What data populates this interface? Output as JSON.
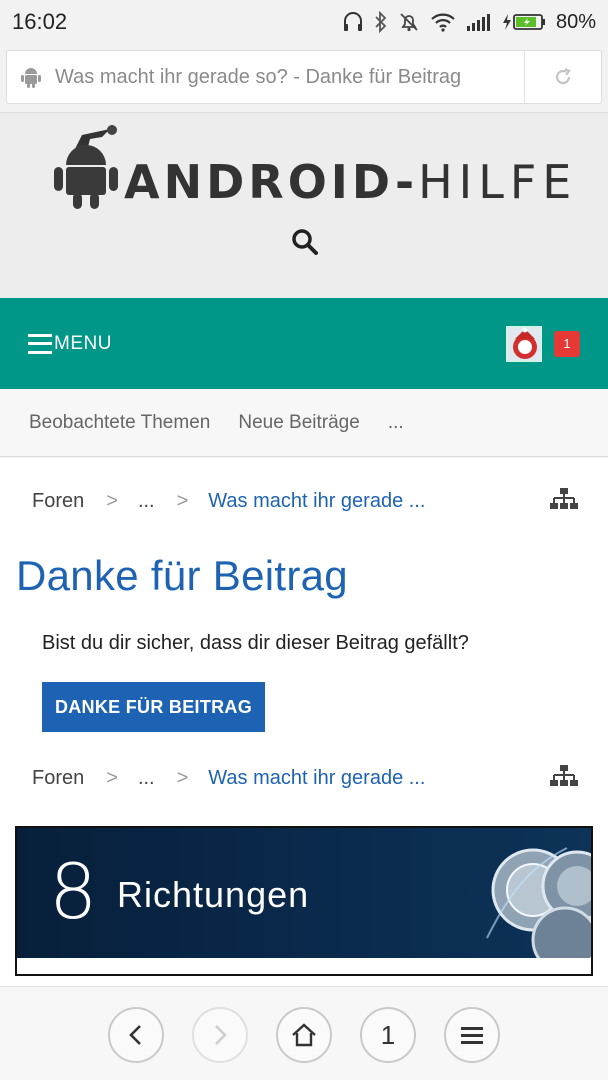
{
  "status_bar": {
    "time": "16:02",
    "battery_percent": "80%",
    "icons": [
      "headphones-icon",
      "bluetooth-icon",
      "silent-bell-icon",
      "wifi-icon",
      "signal-icon",
      "charging-battery-icon"
    ]
  },
  "url_bar": {
    "text": "Was macht ihr gerade so? - Danke für Beitrag",
    "site_icon": "android-icon",
    "reload_icon": "reload-icon"
  },
  "header": {
    "logo_bold": "ANDROID-",
    "logo_thin": "HILFE",
    "search_icon": "search-icon"
  },
  "nav": {
    "menu_label": "MENU",
    "notification_count": "1",
    "colors": {
      "bar": "#009688",
      "badge": "#e53935"
    }
  },
  "sub_nav": {
    "items": [
      "Beobachtete Themen",
      "Neue Beiträge",
      "..."
    ]
  },
  "breadcrumb": {
    "root": "Foren",
    "middle": "...",
    "current": "Was macht ihr gerade ...",
    "separator": ">"
  },
  "main": {
    "title": "Danke für Beitrag",
    "question": "Bist du dir sicher, dass dir dieser Beitrag gefällt?",
    "button_label": "DANKE FÜR BEITRAG",
    "accent": "#1e63b3"
  },
  "ad": {
    "number": "8",
    "word": "Richtungen"
  },
  "browser_bar": {
    "tab_count": "1",
    "icons": [
      "back-icon",
      "forward-icon",
      "home-icon",
      "tabs-icon",
      "menu-icon"
    ]
  }
}
